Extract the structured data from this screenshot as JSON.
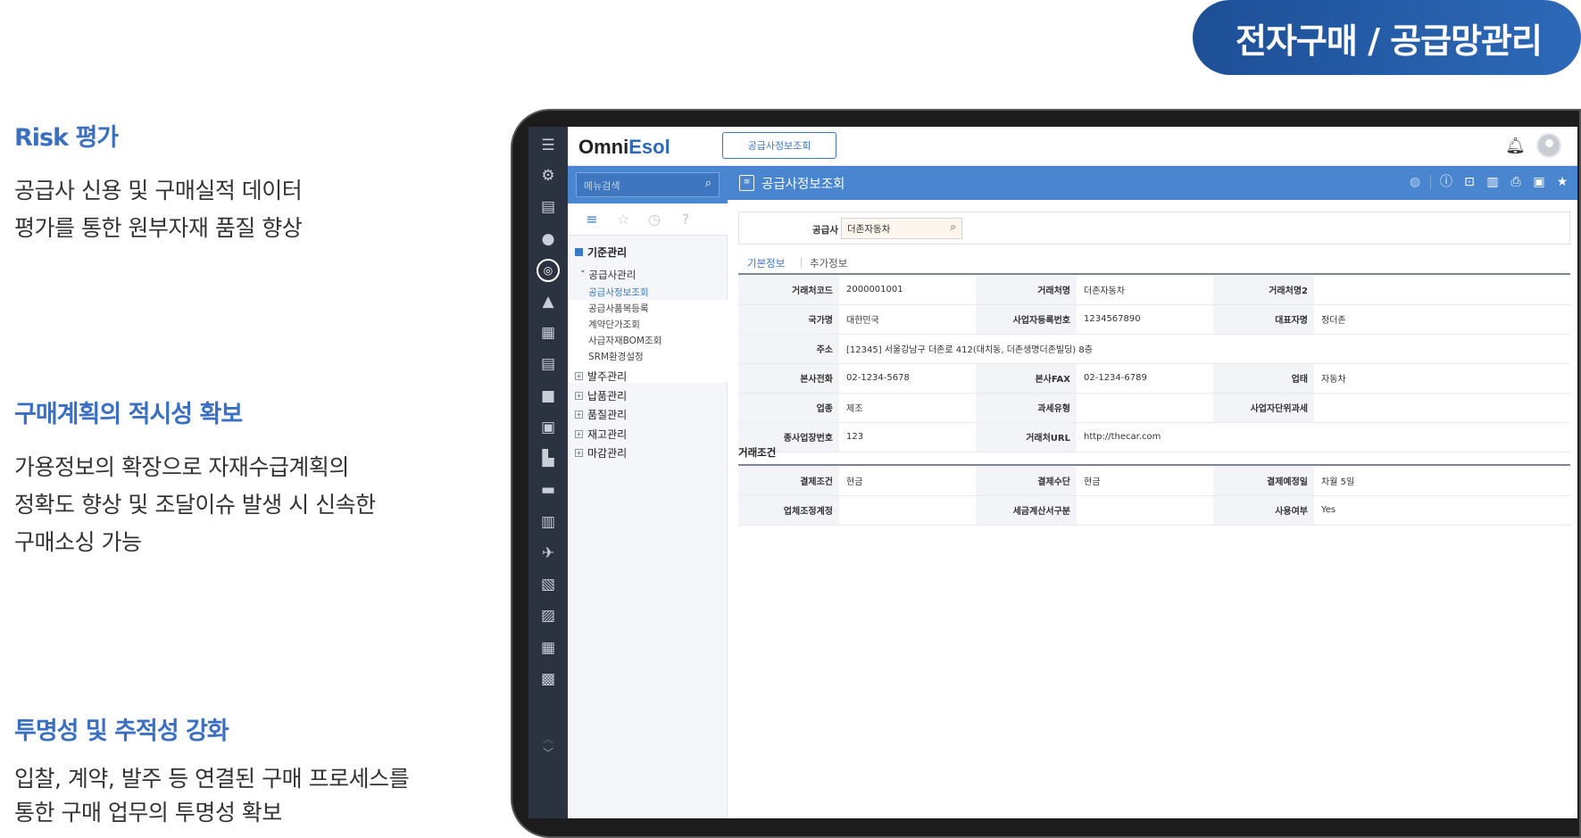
{
  "hero": {
    "title": "전자구매 / 공급망관리"
  },
  "features": [
    {
      "title": "Risk 평가",
      "lines": [
        "공급사 신용 및 구매실적 데이터",
        "평가를 통한 원부자재 품질 향상"
      ]
    },
    {
      "title": "구매계획의 적시성 확보",
      "lines": [
        "가용정보의 확장으로 자재수급계획의",
        "정확도 향상 및 조달이슈 발생 시 신속한",
        "구매소싱 가능"
      ]
    },
    {
      "title": "투명성 및 추적성 강화",
      "lines": [
        "입찰, 계약, 발주 등 연결된 구매 프로세스를",
        "통한 구매 업무의 투명성 확보"
      ]
    }
  ],
  "app": {
    "logo_main": "Omni",
    "logo_accent": "Esol",
    "open_tab": "공급사정보조회",
    "menu": {
      "search_placeholder": "메뉴검색",
      "groups": {
        "base": "기준관리",
        "supplier": "공급사관리",
        "leaves": [
          "공급사정보조회",
          "공급사품목등록",
          "계약단가조회",
          "사급자재BOM조회",
          "SRM환경설정"
        ],
        "others": [
          "발주관리",
          "납품관리",
          "품질관리",
          "재고관리",
          "마감관리"
        ]
      }
    },
    "content": {
      "title": "공급사정보조회",
      "supplier_label": "공급사",
      "supplier_value": "더존자동차",
      "tabs": [
        "기본정보",
        "추가정보"
      ],
      "basic": {
        "r1": {
          "l1": "거래처코드",
          "v1": "2000001001",
          "l2": "거래처명",
          "v2": "더존자동차",
          "l3": "거래처명2",
          "v3": ""
        },
        "r2": {
          "l1": "국가명",
          "v1": "대한민국",
          "l2": "사업자등록번호",
          "v2": "1234567890",
          "l3": "대표자명",
          "v3": "정더존"
        },
        "r3": {
          "l1": "주소",
          "v1": "[12345] 서울강남구 더존로 412(대치동, 더존생명더존빌딩) 8층"
        },
        "r4": {
          "l1": "본사전화",
          "v1": "02-1234-5678",
          "l2": "본사FAX",
          "v2": "02-1234-6789",
          "l3": "업태",
          "v3": "자동차"
        },
        "r5": {
          "l1": "업종",
          "v1": "제조",
          "l2": "과세유형",
          "v2": "",
          "l3": "사업자단위과세",
          "v3": ""
        },
        "r6": {
          "l1": "종사업장번호",
          "v1": "123",
          "l2": "거래처URL",
          "v2": "http://thecar.com",
          "l3": "",
          "v3": ""
        }
      },
      "section_title": "거래조건",
      "terms": {
        "r1": {
          "l1": "결제조건",
          "v1": "현금",
          "l2": "결제수단",
          "v2": "현금",
          "l3": "결제예정일",
          "v3": "차월 5일"
        },
        "r2": {
          "l1": "업체조정계정",
          "v1": "",
          "l2": "세금계산서구분",
          "v2": "",
          "l3": "사용여부",
          "v3": "Yes"
        }
      }
    }
  },
  "icons": [
    "hamburger-icon",
    "gear-icon",
    "document-settings-icon",
    "user-icon",
    "globe-icon",
    "worker-icon",
    "calculator-icon",
    "gear-document-icon",
    "truck-icon",
    "grid-icon",
    "boxes-icon",
    "briefcase-icon",
    "building-icon",
    "airplane-icon",
    "file-settings-icon",
    "files-icon",
    "calculator-settings-icon",
    "percent-icon",
    "chevron-down-icon",
    "bell-icon",
    "avatar-icon",
    "info-icon",
    "preview-icon",
    "trash-icon",
    "print-icon",
    "save-icon",
    "star-icon"
  ],
  "colors": {
    "accent": "#3a78c8",
    "header_bar": "#4a86cf",
    "rail": "#2c3340",
    "hero": "#1d4f96"
  }
}
